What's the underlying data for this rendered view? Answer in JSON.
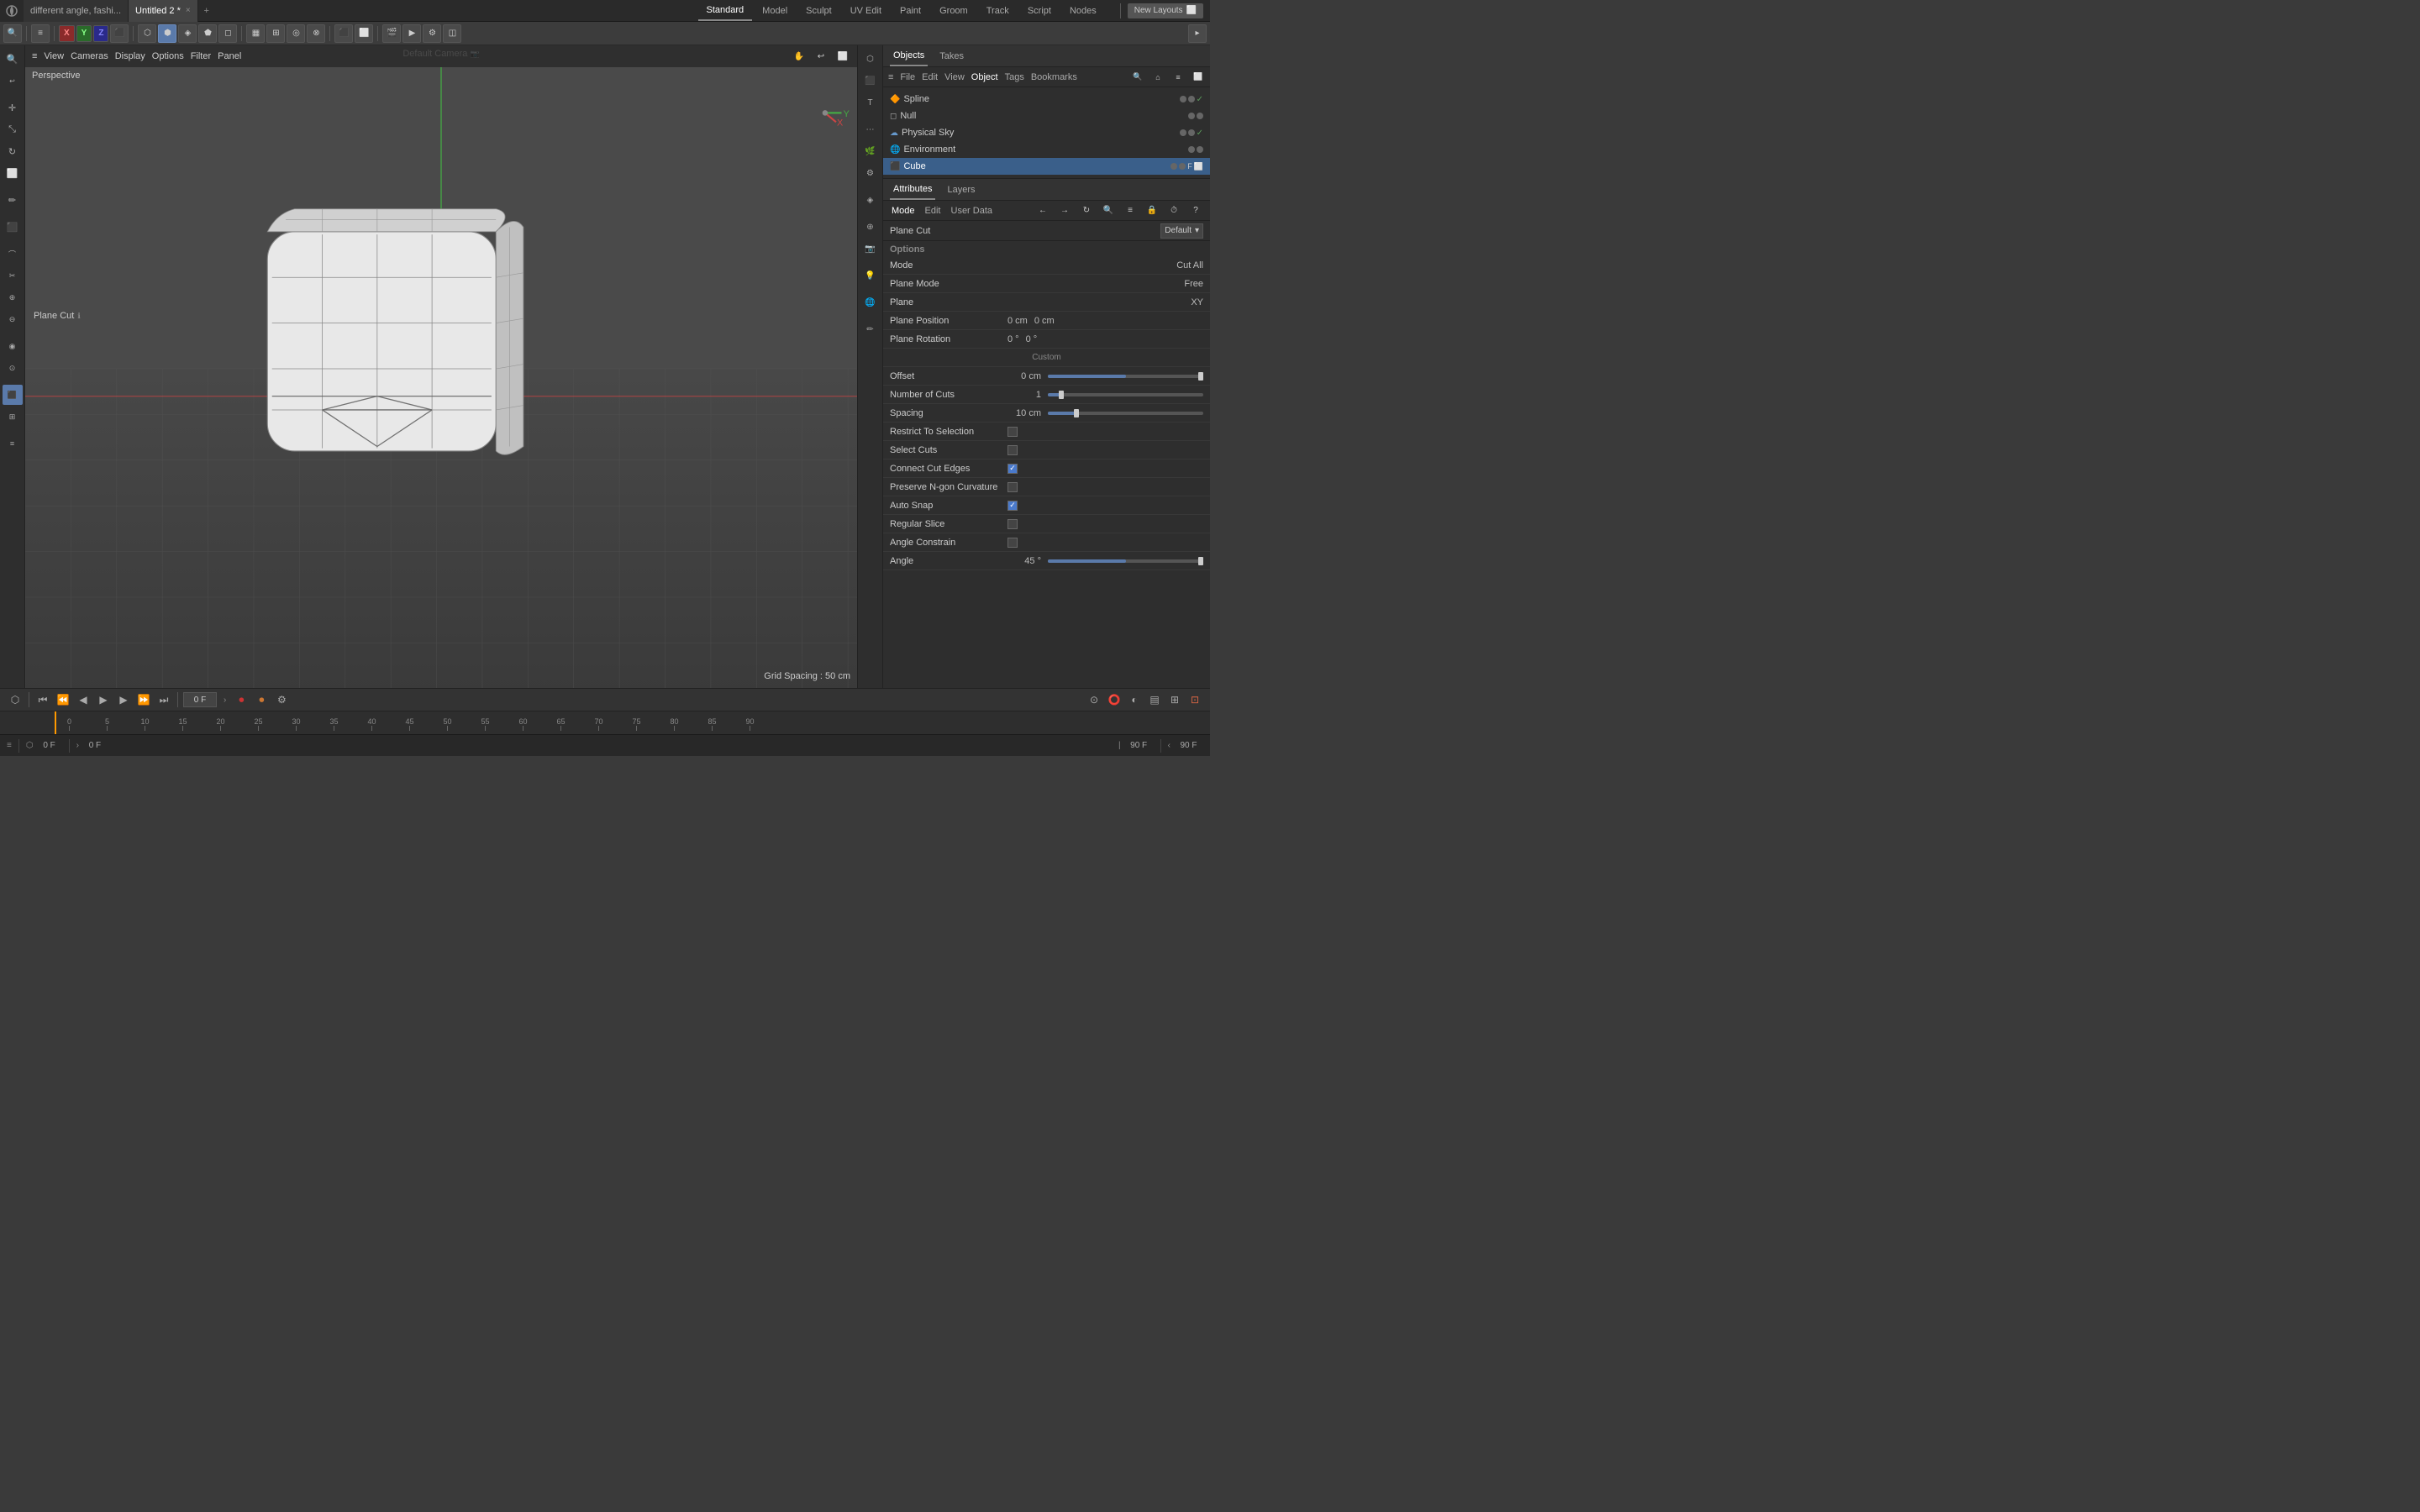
{
  "topbar": {
    "app_hint": "different angle, fashi...",
    "active_tab": "Untitled 2 *",
    "close_label": "×",
    "add_tab_label": "+",
    "nav_tabs": [
      "Standard",
      "Model",
      "Sculpt",
      "UV Edit",
      "Paint",
      "Groom",
      "Track",
      "Script",
      "Nodes"
    ],
    "active_nav": "Standard",
    "new_layouts_label": "New Layouts",
    "toggle_label": "⬜"
  },
  "toolbar": {
    "axis_x": "X",
    "axis_y": "Y",
    "axis_z": "Z"
  },
  "viewport": {
    "label": "Perspective",
    "camera": "Default Camera",
    "plane_cut_label": "Plane Cut",
    "grid_spacing": "Grid Spacing : 50 cm",
    "menu_items": [
      "≡",
      "View",
      "Cameras",
      "Display",
      "Options",
      "Filter",
      "Panel"
    ]
  },
  "right_panel": {
    "top_tabs": [
      "Objects",
      "Takes"
    ],
    "active_top_tab": "Objects",
    "menu_items": [
      "≡",
      "File",
      "Edit",
      "View",
      "Object",
      "Tags",
      "Bookmarks"
    ],
    "active_menu": "Object",
    "tree_items": [
      {
        "label": "Spline",
        "icon": "🔶",
        "has_dot": true,
        "checked": true
      },
      {
        "label": "Null",
        "icon": "⬜",
        "has_dot": true,
        "checked": false
      },
      {
        "label": "Physical Sky",
        "icon": "☁",
        "has_dot": true,
        "checked": true
      },
      {
        "label": "Environment",
        "icon": "🌐",
        "has_dot": true,
        "checked": false
      },
      {
        "label": "Cube",
        "icon": "⬛",
        "has_dot": true,
        "checked": true,
        "selected": true
      }
    ]
  },
  "attributes": {
    "tabs": [
      "Attributes",
      "Layers"
    ],
    "active_tab": "Attributes",
    "toolbar_items": [
      "Mode",
      "Edit",
      "User Data"
    ],
    "mode_items": [
      "←",
      "→",
      "⟳",
      "🔍",
      "≡",
      "🔒",
      "⏱",
      "?"
    ],
    "plane_cut_label": "Plane Cut",
    "dropdown_label": "Default",
    "options_label": "Options",
    "fields": [
      {
        "label": "Mode",
        "value": "Cut All",
        "type": "text"
      },
      {
        "label": "Plane Mode",
        "value": "Free",
        "type": "text"
      },
      {
        "label": "Plane",
        "value": "XY",
        "type": "text"
      },
      {
        "label": "Plane Position",
        "val1": "0 cm",
        "val2": "0 cm",
        "type": "dual"
      },
      {
        "label": "Plane Rotation",
        "val1": "0 °",
        "val2": "0 °",
        "type": "dual"
      },
      {
        "label": "Offset",
        "value": "0 cm",
        "type": "slider"
      },
      {
        "label": "Number of Cuts",
        "value": "1",
        "type": "slider"
      },
      {
        "label": "Spacing",
        "value": "10 cm",
        "type": "slider"
      },
      {
        "label": "Restrict To Selection",
        "checked": false,
        "type": "checkbox"
      },
      {
        "label": "Select Cuts",
        "checked": false,
        "type": "checkbox"
      },
      {
        "label": "Connect Cut Edges",
        "checked": true,
        "type": "checkbox"
      },
      {
        "label": "Preserve N-gon Curvature",
        "checked": false,
        "type": "checkbox"
      },
      {
        "label": "Auto Snap",
        "checked": true,
        "type": "checkbox"
      },
      {
        "label": "Regular Slice",
        "checked": false,
        "type": "checkbox"
      },
      {
        "label": "Angle Constrain",
        "checked": false,
        "type": "checkbox"
      },
      {
        "label": "Angle",
        "value": "45 °",
        "type": "slider"
      }
    ]
  },
  "timeline": {
    "play_label": "▶",
    "frame_value": "0 F",
    "end_frame": "90 F",
    "start_end_1": "0 F",
    "start_end_2": "90 F",
    "ruler_marks": [
      "0",
      "5",
      "10",
      "15",
      "20",
      "25",
      "30",
      "35",
      "40",
      "45",
      "50",
      "55",
      "60",
      "65",
      "70",
      "75",
      "80",
      "85",
      "90"
    ]
  },
  "status_bar": {
    "items": [
      "▶ 0 F",
      "0 F",
      "90 F"
    ]
  }
}
